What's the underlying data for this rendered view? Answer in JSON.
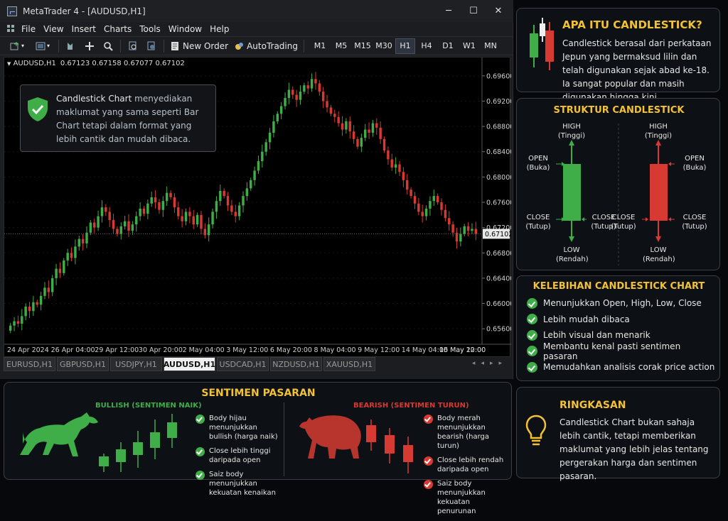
{
  "window": {
    "title": "MetaTrader 4 - [AUDUSD,H1]",
    "minimize": "─",
    "maximize": "☐",
    "close": "✕"
  },
  "menu": [
    "File",
    "View",
    "Insert",
    "Charts",
    "Tools",
    "Window",
    "Help"
  ],
  "toolbar": {
    "new_order": "New Order",
    "autotrading": "AutoTrading",
    "timeframes": [
      "M1",
      "M5",
      "M15",
      "M30",
      "H1",
      "H4",
      "D1",
      "W1",
      "MN"
    ],
    "active_timeframe": "H1"
  },
  "chart_header": {
    "symbol": "AUDUSD,H1",
    "ohlc": "0.67123 0.67158 0.67077 0.67102"
  },
  "info_box": {
    "text_highlight": "Candlestick Chart",
    "text_rest": " menyediakan maklumat yang sama seperti Bar Chart tetapi dalam format yang lebih cantik dan mudah dibaca."
  },
  "price_labels": [
    "0.69600",
    "0.69200",
    "0.68800",
    "0.68400",
    "0.68000",
    "0.67600",
    "0.67200",
    "0.66800",
    "0.66400",
    "0.66000",
    "0.65600"
  ],
  "current_price": "0.67102",
  "date_labels": [
    "24 Apr 2024",
    "26 Apr 04:00",
    "29 Apr 12:00",
    "30 Apr 20:00",
    "2 May 04:00",
    "3 May 12:00",
    "6 May 20:00",
    "8 May 04:00",
    "9 May 12:00",
    "14 May 04:00",
    "15 May 12:00",
    "16 May 20:00"
  ],
  "symbol_tabs": [
    "EURUSD,H1",
    "GBPUSD,H1",
    "USDJPY,H1",
    "AUDUSD,H1",
    "USDCAD,H1",
    "NZDUSD,H1",
    "XAUUSD,H1"
  ],
  "active_tab": "AUDUSD,H1",
  "chart_data": {
    "type": "candlestick",
    "symbol": "AUDUSD",
    "timeframe": "H1",
    "ylim": [
      0.654,
      0.698
    ],
    "close_series": [
      0.6565,
      0.6572,
      0.6568,
      0.658,
      0.6595,
      0.6588,
      0.6602,
      0.6598,
      0.6612,
      0.6625,
      0.6618,
      0.664,
      0.6655,
      0.6648,
      0.6668,
      0.668,
      0.6672,
      0.669,
      0.6702,
      0.6695,
      0.6712,
      0.6728,
      0.672,
      0.6738,
      0.6752,
      0.6745,
      0.6732,
      0.6718,
      0.671,
      0.6722,
      0.673,
      0.6715,
      0.6725,
      0.6738,
      0.675,
      0.6742,
      0.6758,
      0.6768,
      0.676,
      0.6748,
      0.6762,
      0.6775,
      0.6768,
      0.6752,
      0.6738,
      0.673,
      0.6745,
      0.6738,
      0.6725,
      0.674,
      0.6718,
      0.6708,
      0.6725,
      0.6745,
      0.6762,
      0.6778,
      0.677,
      0.6755,
      0.6745,
      0.6738,
      0.6755,
      0.677,
      0.6782,
      0.6795,
      0.681,
      0.6825,
      0.684,
      0.6855,
      0.687,
      0.6888,
      0.69,
      0.6912,
      0.6925,
      0.6938,
      0.693,
      0.6922,
      0.6935,
      0.6945,
      0.694,
      0.6955,
      0.6948,
      0.6935,
      0.692,
      0.691,
      0.69,
      0.6895,
      0.6885,
      0.6875,
      0.6888,
      0.6872,
      0.686,
      0.6848,
      0.6862,
      0.6875,
      0.687,
      0.6885,
      0.6878,
      0.686,
      0.6842,
      0.6828,
      0.6815,
      0.682,
      0.6808,
      0.6795,
      0.678,
      0.677,
      0.6758,
      0.6745,
      0.6738,
      0.675,
      0.6762,
      0.677,
      0.676,
      0.6748,
      0.6735,
      0.6725,
      0.6712,
      0.6698,
      0.671,
      0.6722,
      0.6715,
      0.6718,
      0.671
    ]
  },
  "panels": {
    "apa": {
      "title": "APA ITU CANDLESTICK?",
      "text": "Candlestick berasal dari perkataan Jepun yang bermaksud lilin dan telah digunakan sejak abad ke-18. Ia sangat popular dan masih digunakan hingga kini."
    },
    "struktur": {
      "title": "STRUKTUR CANDLESTICK",
      "high": "HIGH",
      "high_sub": "(Tinggi)",
      "low": "LOW",
      "low_sub": "(Rendah)",
      "open": "OPEN",
      "open_sub": "(Buka)",
      "close": "CLOSE",
      "close_sub": "(Tutup)"
    },
    "kelebihan": {
      "title": "KELEBIHAN CANDLESTICK CHART",
      "items": [
        "Menunjukkan Open, High, Low, Close",
        "Lebih mudah dibaca",
        "Lebih visual dan menarik",
        "Membantu kenal pasti sentimen pasaran",
        "Memudahkan analisis corak price action"
      ]
    },
    "ringkasan": {
      "title": "RINGKASAN",
      "text": "Candlestick Chart bukan sahaja lebih cantik, tetapi memberikan maklumat yang lebih jelas tentang pergerakan harga dan sentimen pasaran."
    },
    "sentimen": {
      "title": "SENTIMEN PASARAN",
      "bull_title": "BULLISH (SENTIMEN NAIK)",
      "bear_title": "BEARISH (SENTIMEN TURUN)",
      "bull_points": [
        "Body hijau menunjukkan bullish (harga naik)",
        "Close lebih tinggi daripada open",
        "Saiz body menunjukkan kekuatan kenaikan"
      ],
      "bear_points": [
        "Body merah menunjukkan bearish (harga turun)",
        "Close lebih rendah daripada open",
        "Saiz body menunjukkan kekuatan penurunan"
      ]
    }
  },
  "colors": {
    "bull": "#3fae49",
    "bear": "#d63a32",
    "accent": "#f2c234"
  }
}
